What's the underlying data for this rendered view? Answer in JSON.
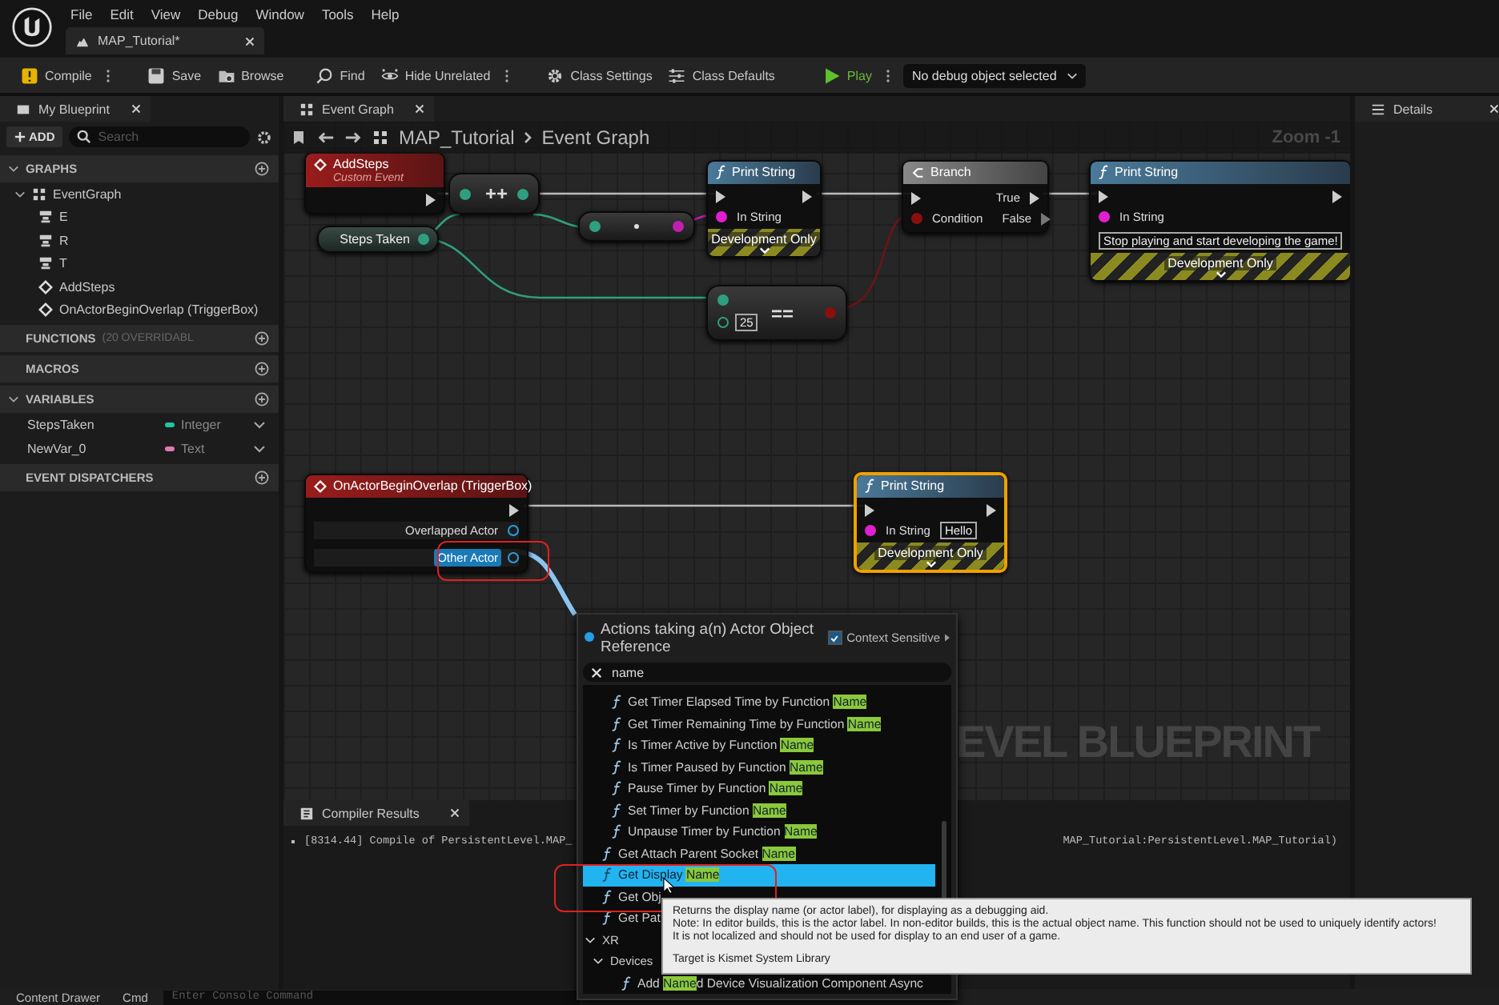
{
  "menu": [
    "File",
    "Edit",
    "View",
    "Debug",
    "Window",
    "Tools",
    "Help"
  ],
  "document_tab": {
    "title": "MAP_Tutorial*"
  },
  "toolbar": [
    {
      "kind": "compile",
      "label": "Compile",
      "menu": true
    },
    {
      "kind": "save",
      "label": "Save",
      "menu": false
    },
    {
      "kind": "browse",
      "label": "Browse",
      "menu": false
    },
    {
      "kind": "find",
      "label": "Find",
      "menu": false
    },
    {
      "kind": "hide",
      "label": "Hide Unrelated",
      "menu": true
    },
    {
      "kind": "settings",
      "label": "Class Settings",
      "menu": false
    },
    {
      "kind": "defaults",
      "label": "Class Defaults",
      "menu": false
    },
    {
      "kind": "play",
      "label": "Play",
      "menu": true
    }
  ],
  "debug_select": {
    "value": "No debug object selected"
  },
  "my_blueprint": {
    "tab": "My Blueprint",
    "add": "ADD",
    "search_placeholder": "Search",
    "sections": [
      {
        "label": "GRAPHS",
        "expanded": true,
        "tree": [
          {
            "label": "EventGraph",
            "kind": "graph",
            "expanded": true,
            "children": [
              {
                "label": "E",
                "kind": "key"
              },
              {
                "label": "R",
                "kind": "key"
              },
              {
                "label": "T",
                "kind": "key"
              },
              {
                "label": "AddSteps",
                "kind": "event"
              },
              {
                "label": "OnActorBeginOverlap (TriggerBox)",
                "kind": "event"
              }
            ]
          }
        ]
      },
      {
        "label": "FUNCTIONS",
        "note": "(20 OVERRIDABL"
      },
      {
        "label": "MACROS"
      },
      {
        "label": "VARIABLES",
        "expanded": true,
        "variables": [
          {
            "name": "StepsTaken",
            "type": "Integer",
            "color": "#1fc8a0"
          },
          {
            "name": "NewVar_0",
            "type": "Text",
            "color": "#e07ab0"
          }
        ]
      },
      {
        "label": "EVENT DISPATCHERS"
      }
    ]
  },
  "graph": {
    "tab": "Event Graph",
    "breadcrumb": [
      "MAP_Tutorial",
      "Event Graph"
    ],
    "zoom": "Zoom -1",
    "watermark": "EVEL BLUEPRINT",
    "nodes": [
      {
        "kind": "event",
        "title": "AddSteps",
        "subtitle": "Custom Event",
        "selected": false
      },
      {
        "kind": "operator",
        "symbol": "++",
        "selected": false
      },
      {
        "kind": "variable",
        "title": "Steps Taken",
        "selected": false
      },
      {
        "kind": "conversion",
        "selected": false
      },
      {
        "kind": "function",
        "title": "Print String",
        "footer": "Development Only",
        "selected": false,
        "inputs": [
          {
            "label": "In String",
            "color": "#e020d0"
          }
        ]
      },
      {
        "kind": "branch",
        "title": "Branch",
        "selected": false,
        "inputs": [
          {
            "label": "Condition",
            "color": "#8a1010"
          }
        ],
        "outputs": [
          {
            "label": "True"
          },
          {
            "label": "False"
          }
        ]
      },
      {
        "kind": "function",
        "title": "Print String",
        "footer": "Development Only",
        "selected": false,
        "inputs": [
          {
            "label": "In String",
            "color": "#e020d0",
            "value": "Stop playing and start developing the game!"
          }
        ]
      },
      {
        "kind": "operator",
        "symbol": "==",
        "value": "25",
        "selected": false
      },
      {
        "kind": "event",
        "title": "OnActorBeginOverlap (TriggerBox)",
        "selected": false,
        "outputs": [
          {
            "label": "Overlapped Actor",
            "color": "#2aa0e0",
            "selected": false
          },
          {
            "label": "Other Actor",
            "color": "#2aa0e0",
            "selected": true
          }
        ]
      },
      {
        "kind": "function",
        "title": "Print String",
        "footer": "Development Only",
        "selected": true,
        "inputs": [
          {
            "label": "In String",
            "color": "#e020d0",
            "value": "Hello"
          }
        ]
      }
    ]
  },
  "compiler": {
    "tab": "Compiler Results",
    "log": [
      "[8314.44] Compile of PersistentLevel.MAP_",
      "MAP_Tutorial:PersistentLevel.MAP_Tutorial)"
    ]
  },
  "details": {
    "tab": "Details"
  },
  "action_menu": {
    "title": "Actions taking a(n) Actor Object Reference",
    "context_sensitive": {
      "label": "Context Sensitive",
      "checked": true
    },
    "search": "name",
    "items": [
      {
        "kind": "group",
        "children": [
          {
            "kind": "function",
            "before": "Get Timer Elapsed Time by Function ",
            "match": "Name",
            "selected": false
          },
          {
            "kind": "function",
            "before": "Get Timer Remaining Time by Function ",
            "match": "Name",
            "selected": false
          },
          {
            "kind": "function",
            "before": "Is Timer Active by Function ",
            "match": "Name",
            "selected": false
          },
          {
            "kind": "function",
            "before": "Is Timer Paused by Function ",
            "match": "Name",
            "selected": false
          },
          {
            "kind": "function",
            "before": "Pause Timer by Function ",
            "match": "Name",
            "selected": false
          },
          {
            "kind": "function",
            "before": "Set Timer by Function ",
            "match": "Name",
            "selected": false
          },
          {
            "kind": "function",
            "before": "Unpause Timer by Function ",
            "match": "Name",
            "selected": false
          }
        ]
      },
      {
        "kind": "function",
        "before": "Get Attach Parent Socket ",
        "match": "Name",
        "selected": false
      },
      {
        "kind": "function",
        "before": "Get Display ",
        "match": "Name",
        "selected": true
      },
      {
        "kind": "function",
        "before": "Get Obj",
        "selected": false
      },
      {
        "kind": "function",
        "before": "Get Pat",
        "selected": false
      },
      {
        "kind": "category",
        "label": "XR",
        "expanded": true,
        "children": [
          {
            "kind": "category",
            "label": "Devices",
            "expanded": true,
            "children": [
              {
                "kind": "function",
                "before": "Add ",
                "match": "Name",
                "after": "d Device Visualization Component Async",
                "selected": false
              }
            ]
          }
        ]
      }
    ]
  },
  "tooltip": {
    "lines": [
      "Returns the display name (or actor label), for displaying as a debugging aid.",
      "Note: In editor builds, this is the actor label.  In non-editor builds, this is the actual object name.  This function should not be used to uniquely identify actors!",
      "It is not localized and should not be used for display to an end user of a game."
    ],
    "target": "Target is Kismet System Library"
  },
  "bottom_bar": {
    "content_drawer": "Content Drawer",
    "cmd": "Cmd",
    "console_placeholder": "Enter Console Command"
  }
}
